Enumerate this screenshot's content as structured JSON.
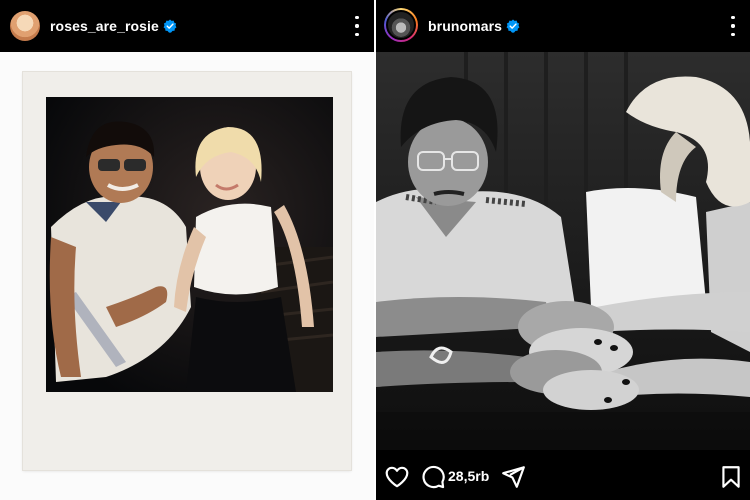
{
  "left_post": {
    "username": "roses_are_rosie",
    "verified": true,
    "avatar": "profile-photo",
    "media": "polaroid-photo-of-two-people-laughing"
  },
  "right_post": {
    "username": "brunomars",
    "verified": true,
    "avatar": "profile-photo-with-story-ring",
    "media": "black-and-white-photo-stacked-hands",
    "comment_count": "28,5rb"
  },
  "icons": {
    "like": "heart-icon",
    "comment": "comment-icon",
    "share": "send-icon",
    "save": "bookmark-icon",
    "more": "more-options-icon",
    "verified": "verified-badge-icon"
  },
  "colors": {
    "background": "#000000",
    "verified_blue": "#0095f6",
    "text": "#ffffff"
  }
}
